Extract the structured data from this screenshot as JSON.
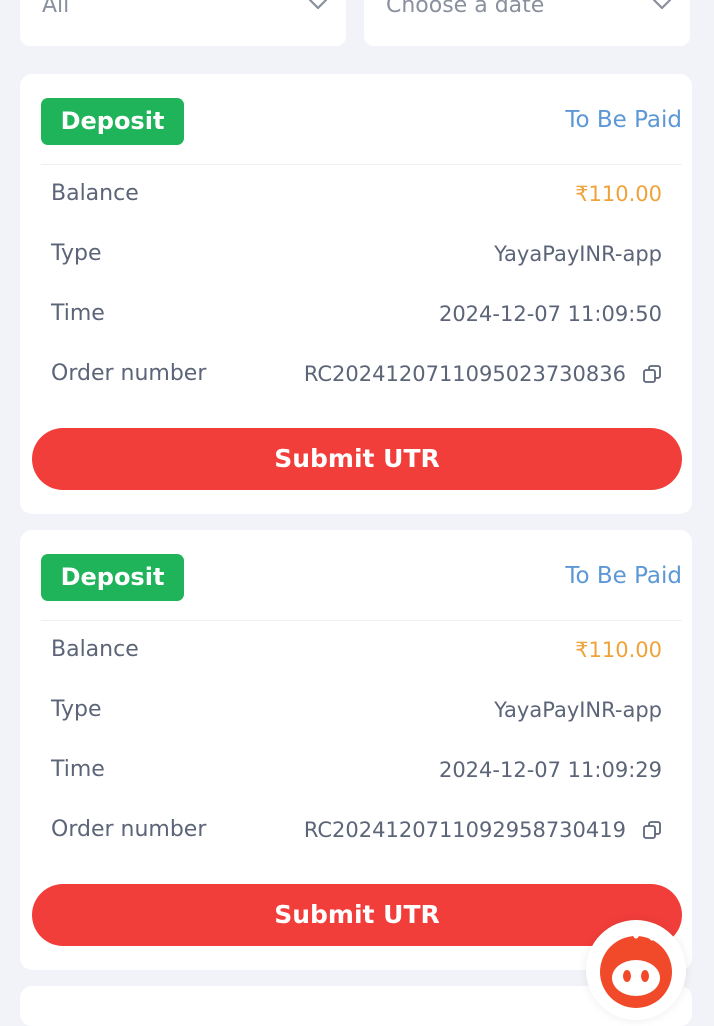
{
  "filters": {
    "category": "All",
    "date_placeholder": "Choose a date"
  },
  "labels": {
    "balance": "Balance",
    "type": "Type",
    "time": "Time",
    "order_number": "Order number"
  },
  "orders": [
    {
      "badge": "Deposit",
      "status": "To Be Paid",
      "balance": "₹110.00",
      "type": "YayaPayINR-app",
      "time": "2024-12-07 11:09:50",
      "order_number": "RC2024120711095023730836",
      "submit_label": "Submit UTR"
    },
    {
      "badge": "Deposit",
      "status": "To Be Paid",
      "balance": "₹110.00",
      "type": "YayaPayINR-app",
      "time": "2024-12-07 11:09:29",
      "order_number": "RC2024120711092958730419",
      "submit_label": "Submit UTR"
    }
  ],
  "colors": {
    "badge_green": "#1fb35a",
    "status_blue": "#5d98d6",
    "balance_orange": "#f0a23a",
    "submit_red": "#f23e3a",
    "background": "#f1f3f8"
  },
  "icons": {
    "dropdown": "chevron-down-icon",
    "copy": "copy-icon",
    "support": "chat-support-icon"
  }
}
